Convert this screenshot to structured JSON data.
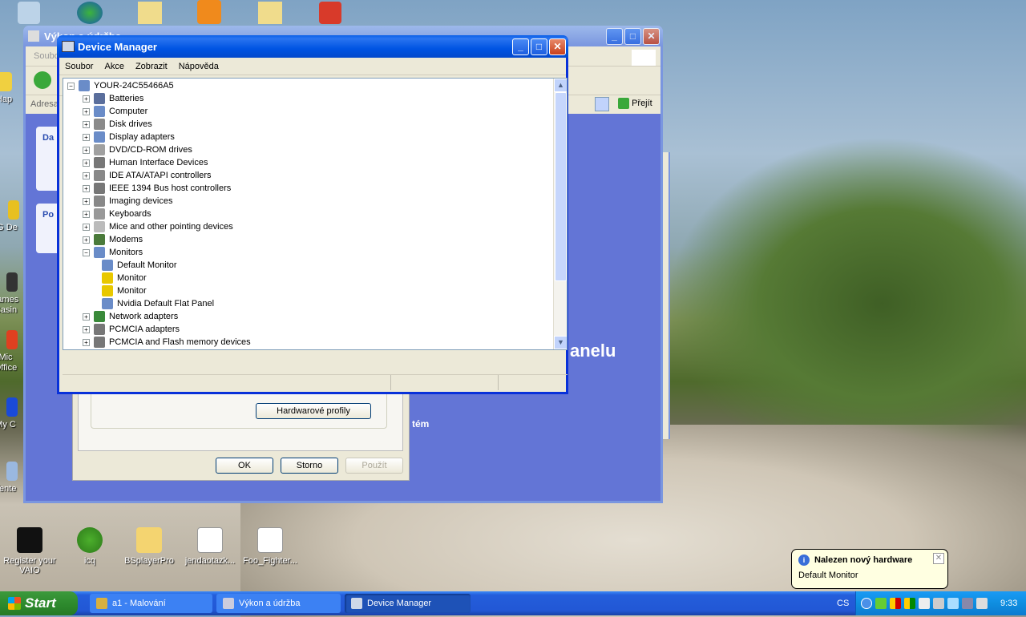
{
  "desktop": {
    "icons_left": [
      "Hap",
      "G De",
      "James Casin",
      "Mic Office",
      "My C",
      "Tente"
    ],
    "icons_bottom": [
      "Register your VAIO",
      "icq",
      "BSplayerPro",
      "jendaotazk...",
      "Foo_Fighter..."
    ]
  },
  "bg_window": {
    "title": "Výkon a údržba",
    "menu": "Soubo",
    "address_label": "Adresa",
    "go_label": "Přejít",
    "panel1": "Da",
    "panel2": "Po",
    "text_big": "anelu",
    "text_small": "tém"
  },
  "dialog": {
    "hw_profiles": "Hardwarové profily",
    "ok": "OK",
    "cancel": "Storno",
    "apply": "Použít"
  },
  "device_manager": {
    "title": "Device Manager",
    "menu": [
      "Soubor",
      "Akce",
      "Zobrazit",
      "Nápověda"
    ],
    "root": "YOUR-24C55466A5",
    "items": [
      {
        "label": "Batteries",
        "state": "collapsed",
        "color": "#5a6e9c"
      },
      {
        "label": "Computer",
        "state": "collapsed",
        "color": "#6a8cc8"
      },
      {
        "label": "Disk drives",
        "state": "collapsed",
        "color": "#8a8a8a"
      },
      {
        "label": "Display adapters",
        "state": "collapsed",
        "color": "#6a8cc8"
      },
      {
        "label": "DVD/CD-ROM drives",
        "state": "collapsed",
        "color": "#a0a0a0"
      },
      {
        "label": "Human Interface Devices",
        "state": "collapsed",
        "color": "#777"
      },
      {
        "label": "IDE ATA/ATAPI controllers",
        "state": "collapsed",
        "color": "#888"
      },
      {
        "label": "IEEE 1394 Bus host controllers",
        "state": "collapsed",
        "color": "#777"
      },
      {
        "label": "Imaging devices",
        "state": "collapsed",
        "color": "#888"
      },
      {
        "label": "Keyboards",
        "state": "collapsed",
        "color": "#999"
      },
      {
        "label": "Mice and other pointing devices",
        "state": "collapsed",
        "color": "#bbb"
      },
      {
        "label": "Modems",
        "state": "collapsed",
        "color": "#4a7a3a"
      },
      {
        "label": "Monitors",
        "state": "expanded",
        "color": "#6a8cc8"
      },
      {
        "label": "Default Monitor",
        "child": true,
        "color": "#6a8cc8"
      },
      {
        "label": "Monitor",
        "child": true,
        "warning": true,
        "color": "#e8c800"
      },
      {
        "label": "Monitor",
        "child": true,
        "warning": true,
        "color": "#e8c800"
      },
      {
        "label": "Nvidia Default Flat Panel",
        "child": true,
        "color": "#6a8cc8"
      },
      {
        "label": "Network adapters",
        "state": "collapsed",
        "color": "#3a8a3a"
      },
      {
        "label": "PCMCIA adapters",
        "state": "collapsed",
        "color": "#777"
      },
      {
        "label": "PCMCIA and Flash memory devices",
        "state": "collapsed",
        "color": "#777"
      }
    ]
  },
  "taskbar": {
    "start": "Start",
    "tasks": [
      "a1 - Malování",
      "Výkon a údržba",
      "Device Manager"
    ],
    "lang": "CS",
    "clock": "9:33"
  },
  "balloon": {
    "title": "Nalezen nový hardware",
    "text": "Default Monitor"
  }
}
